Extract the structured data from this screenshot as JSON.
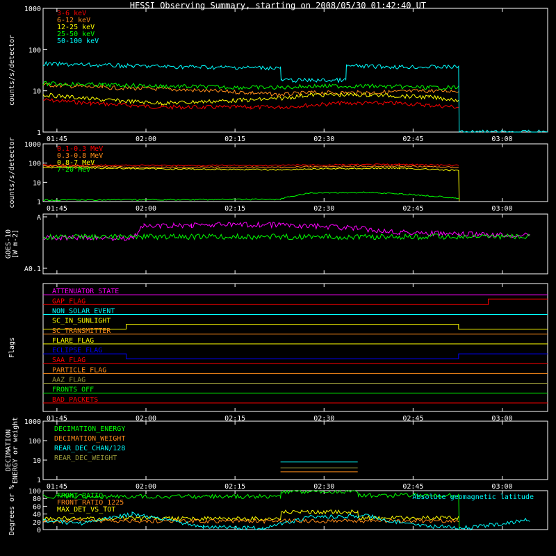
{
  "title": "HESSI Observing Summary, starting on 2008/05/30 01:42:40 UT",
  "time_ticks": [
    "01:45",
    "02:00",
    "02:15",
    "02:30",
    "02:45",
    "03:00",
    "03:15"
  ],
  "colors": {
    "red": "#ff0000",
    "orange": "#ff8c1a",
    "yellow": "#ffff00",
    "green": "#00ff00",
    "cyan": "#00ffff",
    "magenta": "#ff00ff",
    "blue": "#0000ff",
    "olive": "#9a9a3a"
  },
  "chart_data": [
    {
      "type": "line",
      "id": "lowE",
      "ylabel": "counts/s/detector",
      "scale": "log",
      "ylim": [
        1,
        1000
      ],
      "ytick_labels": [
        "1",
        "10",
        "100",
        "1000"
      ],
      "legend": [
        "3-6 keV",
        "6-12 keV",
        "12-25 keV",
        "25-50 keV",
        "50-100 keV"
      ],
      "series": [
        {
          "name": "3-6 keV",
          "color": "#ff0000",
          "points": [
            [
              0,
              6
            ],
            [
              8,
              5
            ],
            [
              20,
              4
            ],
            [
              35,
              4
            ],
            [
              40,
              4
            ],
            [
              50,
              5
            ],
            [
              60,
              5
            ],
            [
              65,
              4.5
            ],
            [
              70,
              4
            ]
          ]
        },
        {
          "name": "6-12 keV",
          "color": "#ff8c1a",
          "points": [
            [
              0,
              14
            ],
            [
              10,
              12
            ],
            [
              20,
              11
            ],
            [
              35,
              9
            ],
            [
              40,
              8
            ],
            [
              45,
              9
            ],
            [
              55,
              9
            ],
            [
              65,
              10
            ],
            [
              70,
              10
            ]
          ]
        },
        {
          "name": "12-25 keV",
          "color": "#ffff00",
          "points": [
            [
              0,
              8
            ],
            [
              10,
              6
            ],
            [
              20,
              5
            ],
            [
              35,
              6
            ],
            [
              40,
              6.5
            ],
            [
              45,
              8
            ],
            [
              55,
              8
            ],
            [
              65,
              7
            ],
            [
              70,
              6
            ]
          ]
        },
        {
          "name": "25-50 keV",
          "color": "#00ff00",
          "points": [
            [
              0,
              15
            ],
            [
              10,
              14
            ],
            [
              20,
              13
            ],
            [
              35,
              12
            ],
            [
              40,
              12
            ],
            [
              45,
              13
            ],
            [
              55,
              13
            ],
            [
              65,
              12
            ],
            [
              70,
              12
            ]
          ]
        },
        {
          "name": "50-100 keV",
          "color": "#00ffff",
          "points": [
            [
              0,
              45
            ],
            [
              15,
              40
            ],
            [
              30,
              37
            ],
            [
              40,
              36
            ],
            [
              40.1,
              18
            ],
            [
              51,
              18
            ],
            [
              51.1,
              40
            ],
            [
              60,
              38
            ],
            [
              70,
              38
            ],
            [
              70.1,
              1
            ],
            [
              85,
              1
            ]
          ]
        }
      ]
    },
    {
      "type": "line",
      "id": "highE",
      "ylabel": "counts/s/detector",
      "scale": "log",
      "ylim": [
        1,
        1000
      ],
      "ytick_labels": [
        "1",
        "10",
        "100",
        "1000"
      ],
      "legend": [
        "0.1-0.3 MeV",
        "0.3-0.8 MeV",
        "0.8-7 MeV",
        "7-20 MeV"
      ],
      "series": [
        {
          "name": "0.1-0.3 MeV",
          "color": "#ff0000",
          "points": [
            [
              0,
              80
            ],
            [
              20,
              75
            ],
            [
              40,
              75
            ],
            [
              45,
              80
            ],
            [
              60,
              85
            ],
            [
              70,
              75
            ]
          ]
        },
        {
          "name": "0.3-0.8 MeV",
          "color": "#ff8c1a",
          "points": [
            [
              0,
              70
            ],
            [
              20,
              60
            ],
            [
              40,
              60
            ],
            [
              45,
              65
            ],
            [
              60,
              70
            ],
            [
              70,
              60
            ]
          ]
        },
        {
          "name": "0.8-7 MeV",
          "color": "#ffff00",
          "points": [
            [
              0,
              60
            ],
            [
              20,
              50
            ],
            [
              40,
              45
            ],
            [
              45,
              50
            ],
            [
              60,
              55
            ],
            [
              70,
              40
            ],
            [
              70.1,
              1
            ]
          ]
        },
        {
          "name": "7-20 MeV",
          "color": "#00ff00",
          "points": [
            [
              0,
              1.2
            ],
            [
              40,
              1.3
            ],
            [
              45,
              2.8
            ],
            [
              55,
              3
            ],
            [
              60,
              2.5
            ],
            [
              70,
              1.5
            ]
          ]
        }
      ]
    },
    {
      "type": "line",
      "id": "goes",
      "ylabel": "GOES-10 [W m-2]",
      "scale": "log",
      "ytick_labels": [
        "A",
        "A0.1"
      ],
      "series": [
        {
          "name": "GOES high",
          "color": "#ff00ff",
          "points": [
            [
              0,
              0.6
            ],
            [
              15,
              0.6
            ],
            [
              17,
              0.8
            ],
            [
              22,
              0.8
            ],
            [
              25,
              0.82
            ],
            [
              40,
              0.82
            ],
            [
              50,
              0.78
            ],
            [
              60,
              0.7
            ],
            [
              70,
              0.66
            ],
            [
              82,
              0.64
            ]
          ]
        },
        {
          "name": "GOES low",
          "color": "#00ff00",
          "points": [
            [
              0,
              0.62
            ],
            [
              82,
              0.62
            ]
          ]
        }
      ]
    },
    {
      "type": "line",
      "id": "flags",
      "ylabel": "Flags",
      "flags": [
        {
          "name": "ATTENUATOR_STATE",
          "color": "#ff00ff"
        },
        {
          "name": "GAP_FLAG",
          "color": "#ff0000"
        },
        {
          "name": "NON_SOLAR_EVENT",
          "color": "#00ffff"
        },
        {
          "name": "SC_IN_SUNLIGHT",
          "color": "#ffff00"
        },
        {
          "name": "SC_TRANSMITTER",
          "color": "#ff8c1a"
        },
        {
          "name": "FLARE_FLAG",
          "color": "#ffff00"
        },
        {
          "name": "ECLIPSE_FLAG",
          "color": "#0000ff"
        },
        {
          "name": "SAA_FLAG",
          "color": "#ff0000"
        },
        {
          "name": "PARTICLE_FLAG",
          "color": "#ff8c1a"
        },
        {
          "name": "AAZ_FLAG",
          "color": "#9a9a3a"
        },
        {
          "name": "FRONTS_OFF",
          "color": "#00ff00"
        },
        {
          "name": "BAD_PACKETS",
          "color": "#ff0000"
        }
      ]
    },
    {
      "type": "line",
      "id": "decim",
      "ylabel": "DECIMATION ENERGY or weight",
      "scale": "log",
      "ylim": [
        1,
        1000
      ],
      "ytick_labels": [
        "1",
        "10",
        "100",
        "1000"
      ],
      "legend": [
        "DECIMATION_ENERGY",
        "DECIMATION_WEIGHT",
        "REAR_DEC_CHAN/128",
        "REAR_DEC_WEIGHT"
      ],
      "series": [
        {
          "name": "REAR_DEC_CHAN/128",
          "color": "#00ffff",
          "points": [
            [
              40,
              8
            ],
            [
              53,
              8
            ]
          ]
        },
        {
          "name": "REAR_DEC_WEIGHT",
          "color": "#9a9a3a",
          "points": [
            [
              40,
              4
            ],
            [
              53,
              4
            ]
          ]
        },
        {
          "name": "DECIMATION_WEIGHT",
          "color": "#ff8c1a",
          "points": [
            [
              40,
              2.5
            ],
            [
              53,
              2.5
            ]
          ]
        }
      ]
    },
    {
      "type": "line",
      "id": "ratio",
      "ylabel": "Degrees or %",
      "ylim": [
        0,
        100
      ],
      "ytick_labels": [
        "0",
        "20",
        "40",
        "60",
        "80",
        "100"
      ],
      "legend": [
        "FRONT_RATIO",
        "FRONT_RATIO_1225",
        "MAX_DET_VS_TOT",
        "Absolute geomagnetic latitude"
      ],
      "series": [
        {
          "name": "FRONT_RATIO",
          "color": "#00ff00",
          "points": [
            [
              0,
              85
            ],
            [
              40,
              85
            ],
            [
              40.1,
              98
            ],
            [
              53,
              98
            ],
            [
              53.1,
              88
            ],
            [
              70,
              88
            ],
            [
              70.1,
              0
            ]
          ]
        },
        {
          "name": "MAX_DET_VS_TOT",
          "color": "#ffff00",
          "points": [
            [
              0,
              28
            ],
            [
              40,
              28
            ],
            [
              40.1,
              45
            ],
            [
              53,
              45
            ],
            [
              53.1,
              30
            ],
            [
              70,
              30
            ]
          ]
        },
        {
          "name": "FRONT_RATIO_1225",
          "color": "#ff8c1a",
          "points": [
            [
              0,
              22
            ],
            [
              70,
              22
            ]
          ]
        },
        {
          "name": "Absolute geomagnetic latitude",
          "color": "#00ffff",
          "points": [
            [
              0,
              25
            ],
            [
              6,
              15
            ],
            [
              15,
              40
            ],
            [
              27,
              8
            ],
            [
              37,
              3
            ],
            [
              45,
              32
            ],
            [
              55,
              35
            ],
            [
              60,
              18
            ],
            [
              65,
              8
            ],
            [
              72,
              5
            ],
            [
              82,
              25
            ]
          ]
        }
      ]
    }
  ]
}
